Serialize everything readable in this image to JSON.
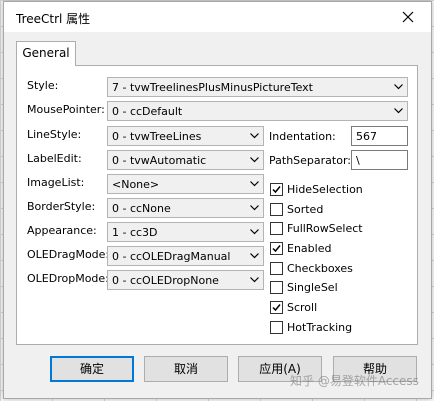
{
  "window": {
    "title": "TreeCtrl 属性",
    "close_icon": "close-icon"
  },
  "tabs": [
    {
      "label": "General"
    }
  ],
  "fields": {
    "style": {
      "label": "Style:",
      "value": "7 - tvwTreelinesPlusMinusPictureText"
    },
    "mouse_pointer": {
      "label": "MousePointer:",
      "value": "0 - ccDefault"
    },
    "line_style": {
      "label": "LineStyle:",
      "value": "0 - tvwTreeLines"
    },
    "label_edit": {
      "label": "LabelEdit:",
      "value": "0 - tvwAutomatic"
    },
    "image_list": {
      "label": "ImageList:",
      "value": "<None>"
    },
    "border_style": {
      "label": "BorderStyle:",
      "value": "0 - ccNone"
    },
    "appearance": {
      "label": "Appearance:",
      "value": "1 - cc3D"
    },
    "ole_drag_mode": {
      "label": "OLEDragMode:",
      "value": "0 - ccOLEDragManual"
    },
    "ole_drop_mode": {
      "label": "OLEDropMode:",
      "value": "0 - ccOLEDropNone"
    },
    "indentation": {
      "label": "Indentation:",
      "value": "567"
    },
    "path_separator": {
      "label": "PathSeparator:",
      "value": "\\"
    }
  },
  "checkboxes": [
    {
      "label": "HideSelection",
      "checked": true
    },
    {
      "label": "Sorted",
      "checked": false
    },
    {
      "label": "FullRowSelect",
      "checked": false
    },
    {
      "label": "Enabled",
      "checked": true
    },
    {
      "label": "Checkboxes",
      "checked": false
    },
    {
      "label": "SingleSel",
      "checked": false
    },
    {
      "label": "Scroll",
      "checked": true
    },
    {
      "label": "HotTracking",
      "checked": false
    }
  ],
  "buttons": {
    "ok": "确定",
    "cancel": "取消",
    "apply": "应用(A)",
    "help": "帮助"
  },
  "watermark": "知乎 @易登软件Access"
}
